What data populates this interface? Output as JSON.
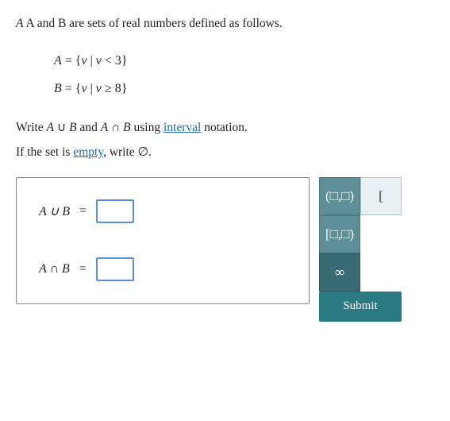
{
  "intro": {
    "line1": "A and B are sets of real numbers defined as follows.",
    "setA_label": "A",
    "setA_def": "A = {v | v < 3}",
    "setB_label": "B",
    "setB_def": "B = {v | v ≥ 8}",
    "write_line1_before": "Write ",
    "write_AUB": "A ∪ B",
    "write_middle": " and ",
    "write_ANB": "A ∩ B",
    "write_using": " using ",
    "interval_link": "interval",
    "write_after": " notation.",
    "empty_line": "If the set is ",
    "empty_link": "empty",
    "empty_after": ", write ",
    "empty_symbol": "∅"
  },
  "answer_box": {
    "row1_label": "A ∪ B",
    "row1_equals": "=",
    "row2_label": "A ∩ B",
    "row2_equals": "="
  },
  "symbol_panel": {
    "row1": [
      {
        "symbol": "(□,□)",
        "label": "open-interval-btn"
      },
      {
        "symbol": "[",
        "label": "open-bracket-btn"
      }
    ],
    "row2": [
      {
        "symbol": "[□,□)",
        "label": "half-open-left-btn"
      }
    ],
    "row3": [
      {
        "symbol": "∞",
        "label": "infinity-btn"
      }
    ]
  },
  "submit": {
    "label": "Submit"
  }
}
